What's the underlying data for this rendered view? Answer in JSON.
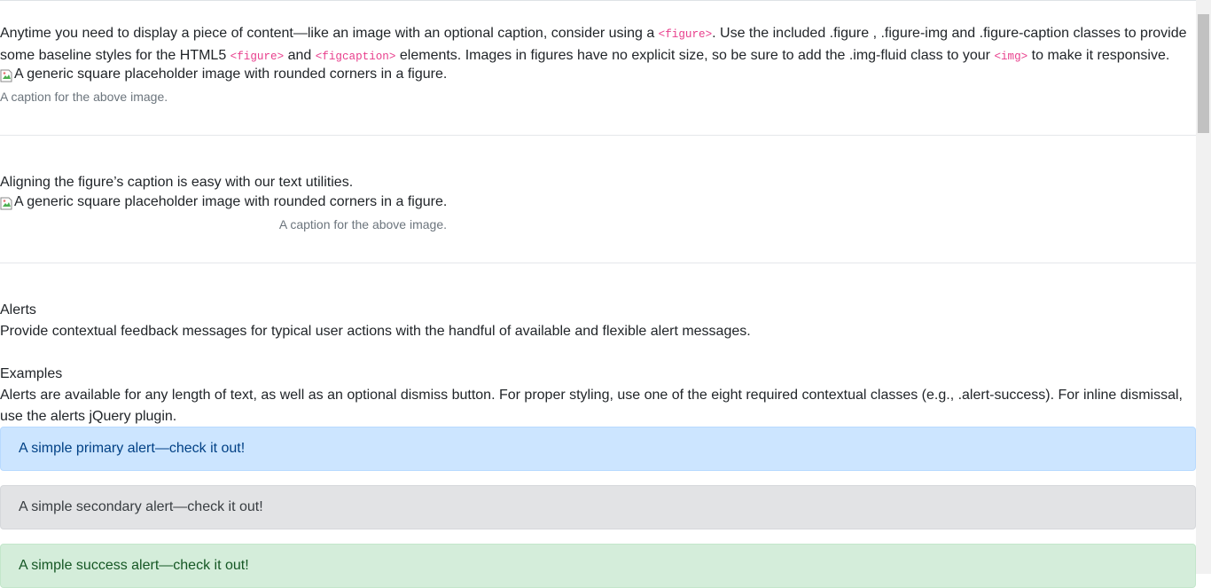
{
  "figure": {
    "intro_parts": [
      "Anytime you need to display a piece of content—like an image with an optional caption, consider using a ",
      "<figure>",
      ". Use the included .figure , .figure-img and .figure-caption classes to provide some baseline styles for the HTML5 ",
      "<figure>",
      " and ",
      "<figcaption>",
      " elements. Images in figures have no explicit size, so be sure to add the .img-fluid class to your ",
      "<img>",
      " to make it responsive."
    ],
    "image_alt": "A generic square placeholder image with rounded corners in a figure.",
    "caption": "A caption for the above image."
  },
  "figure_aligned": {
    "text": "Aligning the figure’s caption is easy with our text utilities.",
    "image_alt": "A generic square placeholder image with rounded corners in a figure.",
    "caption": "A caption for the above image."
  },
  "alerts_section": {
    "title": "Alerts",
    "description": "Provide contextual feedback messages for typical user actions with the handful of available and flexible alert messages.",
    "examples_title": "Examples",
    "examples_text": "Alerts are available for any length of text, as well as an optional dismiss button. For proper styling, use one of the eight required contextual classes (e.g., .alert-success). For inline dismissal, use the alerts jQuery plugin.",
    "alerts": [
      {
        "text": "A simple primary alert—check it out!",
        "bg": "#cce5ff",
        "border": "#b8daff",
        "color": "#004085"
      },
      {
        "text": "A simple secondary alert—check it out!",
        "bg": "#e2e3e5",
        "border": "#d6d8db",
        "color": "#383d41"
      },
      {
        "text": "A simple success alert—check it out!",
        "bg": "#d4edda",
        "border": "#c3e6cb",
        "color": "#155724"
      }
    ]
  },
  "icons": {
    "broken_image": "broken-image-icon"
  }
}
